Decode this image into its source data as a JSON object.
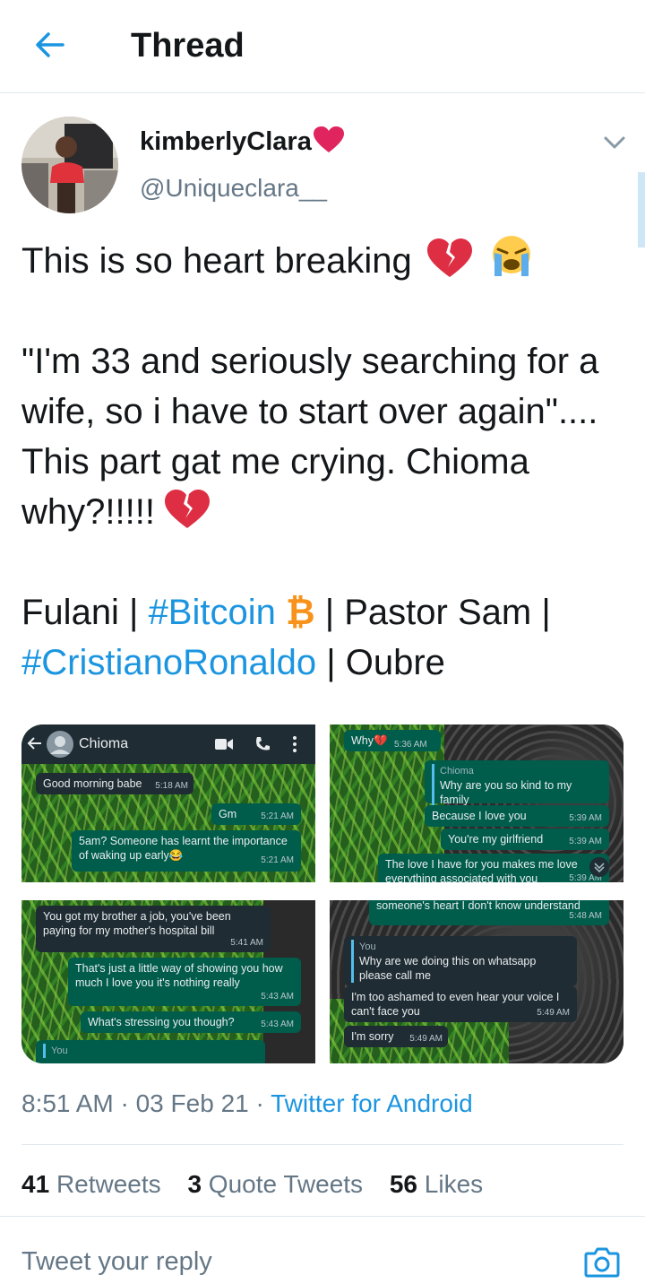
{
  "header": {
    "title": "Thread"
  },
  "author": {
    "name": "kimberlyClara",
    "handle": "@Uniqueclara__"
  },
  "tweet": {
    "line1": "This is so heart breaking",
    "para2": "\"I'm 33 and seriously searching for a wife, so i have to start over again\".... This part gat me crying. Chioma why?!!!!!",
    "trend_fulani": "Fulani | ",
    "trend_bitcoin": "#Bitcoin",
    "trend_btc_symbol": "₿",
    "trend_pastor": " | Pastor Sam |",
    "trend_ronaldo": "#CristianoRonaldo",
    "trend_oubre": " | Oubre"
  },
  "media": {
    "shot1": {
      "contact": "Chioma",
      "msg1": "Good morning babe",
      "t1": "5:18 AM",
      "msg2": "Gm",
      "t2": "5:21 AM",
      "msg3": "5am? Someone has learnt the importance of waking up early😂",
      "t3": "5:21 AM"
    },
    "shot2": {
      "msg0": "Why💔",
      "t0": "5:36 AM",
      "quote_name": "Chioma",
      "quote_text": "Why are you so kind to my family",
      "msg1": "Because I love you",
      "t1": "5:39 AM",
      "msg2": "You're my girlfriend",
      "t2": "5:39 AM",
      "msg3": "The love I have for you makes me love everything associated with you",
      "t3": "5:39 AM"
    },
    "shot3": {
      "msg1": "You got my brother a job, you've been paying for my mother's hospital bill",
      "t1": "5:41 AM",
      "msg2": "That's just a little way of showing you how much I love you it's nothing really",
      "t2": "5:43 AM",
      "msg3": "What's stressing you though?",
      "t3": "5:43 AM",
      "quote_name": "You"
    },
    "shot4": {
      "msg0": "someone's heart I don't know understand",
      "t0": "5:48 AM",
      "quote_name": "You",
      "quote_text": "Why are we doing this on whatsapp please call me",
      "msg1": "I'm too ashamed to even hear your voice I can't face you",
      "t1": "5:49 AM",
      "msg2": "I'm sorry",
      "t2": "5:49 AM"
    }
  },
  "meta": {
    "time": "8:51 AM · 03 Feb 21 · ",
    "source": "Twitter for Android"
  },
  "stats": {
    "retweets_count": "41",
    "retweets_label": "Retweets",
    "quotes_count": "3",
    "quotes_label": "Quote Tweets",
    "likes_count": "56",
    "likes_label": "Likes"
  },
  "reply": {
    "placeholder": "Tweet your reply"
  },
  "colors": {
    "accent": "#1b95e0",
    "muted": "#657786",
    "text": "#14171a",
    "heart": "#e0245e"
  }
}
